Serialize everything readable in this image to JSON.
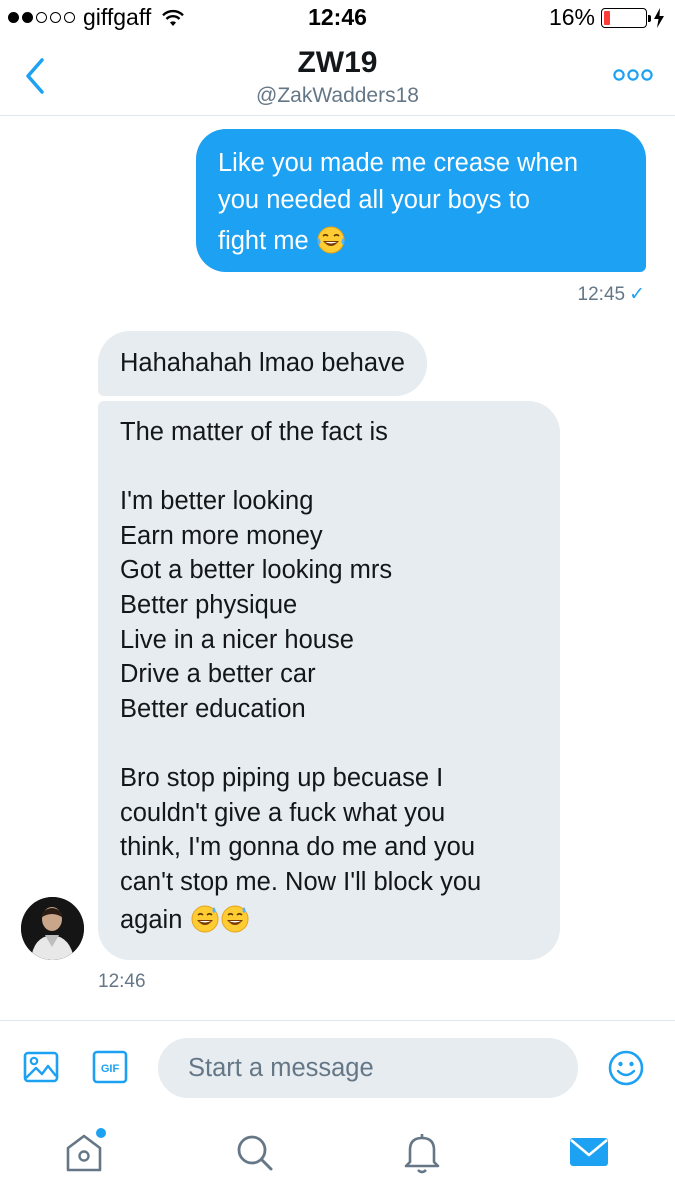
{
  "status_bar": {
    "carrier": "giffgaff",
    "time": "12:46",
    "battery_percent": "16%",
    "battery_level": 0.16,
    "signal_bars_filled": 2,
    "signal_bars_total": 5
  },
  "header": {
    "title": "ZW19",
    "handle": "@ZakWadders18",
    "accent_color": "#1da1f2"
  },
  "messages": {
    "sent": {
      "line1": "Like you made me crease when",
      "line2": "you needed all your boys to",
      "line3": "fight me",
      "emoji": "face-with-tears-of-joy",
      "time": "12:45",
      "status": "✓"
    },
    "received_1": {
      "text": "Hahahahah lmao behave"
    },
    "received_2": {
      "lines": [
        "The matter of the fact is",
        "",
        "I'm better looking",
        "Earn more money",
        "Got a better looking mrs",
        "Better physique",
        "Live in a nicer house",
        "Drive a better car",
        "Better education",
        "",
        "Bro stop piping up becuase I",
        "couldn't give a fuck what you",
        "think, I'm gonna do me and you",
        "can't stop me. Now I'll block you",
        "again"
      ],
      "emojis": [
        "grinning-face-with-sweat",
        "grinning-face-with-sweat"
      ],
      "time": "12:46"
    }
  },
  "composer": {
    "placeholder": "Start a message",
    "value": ""
  },
  "tabs": [
    {
      "name": "home",
      "icon": "home-icon",
      "has_unread": true
    },
    {
      "name": "search",
      "icon": "search-icon",
      "has_unread": false
    },
    {
      "name": "notifications",
      "icon": "bell-icon",
      "has_unread": false
    },
    {
      "name": "messages",
      "icon": "envelope-icon",
      "active": true
    }
  ]
}
